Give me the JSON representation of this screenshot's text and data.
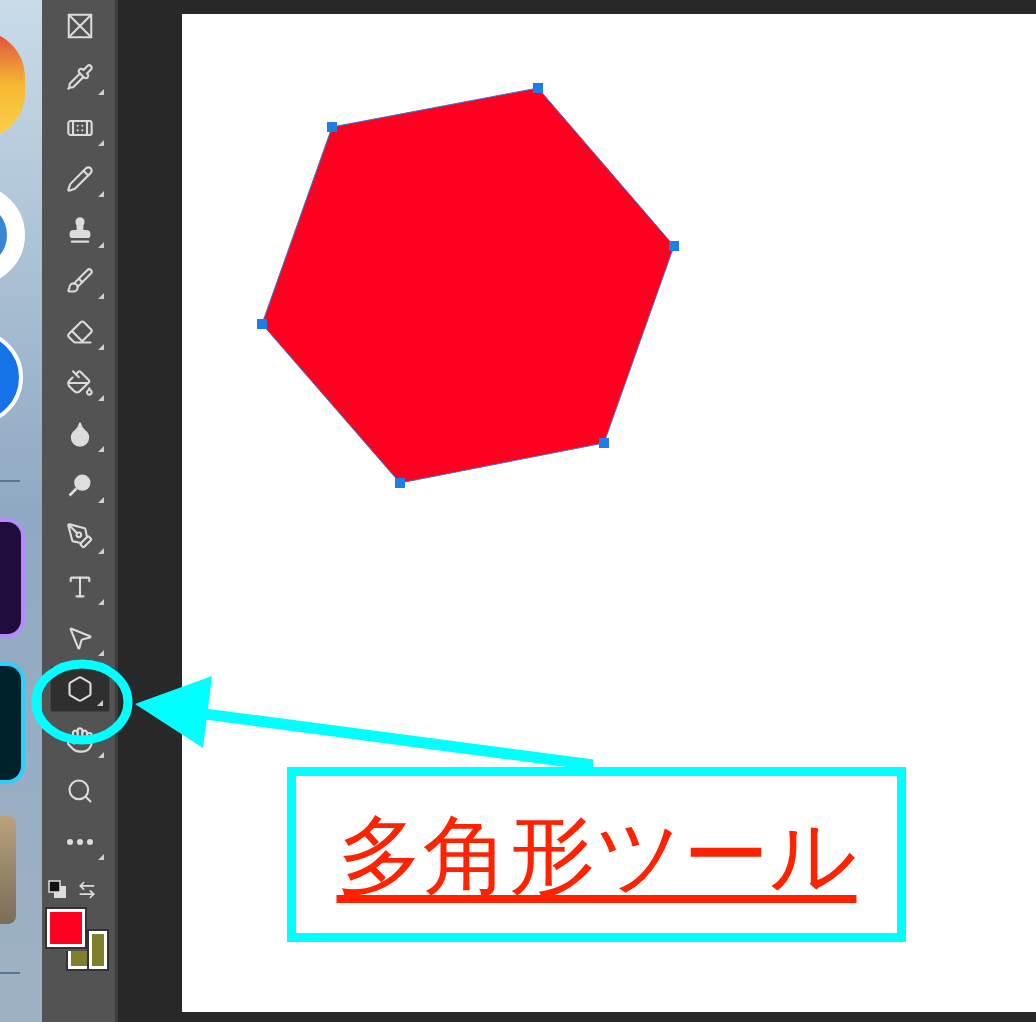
{
  "toolbar": {
    "tools": [
      {
        "kind": "frame",
        "selected": false,
        "has_menu": false
      },
      {
        "kind": "eyedropper",
        "selected": false,
        "has_menu": true
      },
      {
        "kind": "healing",
        "selected": false,
        "has_menu": true
      },
      {
        "kind": "pencil",
        "selected": false,
        "has_menu": true
      },
      {
        "kind": "stamp",
        "selected": false,
        "has_menu": true
      },
      {
        "kind": "history-brush",
        "selected": false,
        "has_menu": true
      },
      {
        "kind": "eraser",
        "selected": false,
        "has_menu": true
      },
      {
        "kind": "bucket",
        "selected": false,
        "has_menu": true
      },
      {
        "kind": "blur",
        "selected": false,
        "has_menu": true
      },
      {
        "kind": "dodge",
        "selected": false,
        "has_menu": true
      },
      {
        "kind": "pen",
        "selected": false,
        "has_menu": true
      },
      {
        "kind": "type",
        "selected": false,
        "has_menu": true
      },
      {
        "kind": "select",
        "selected": false,
        "has_menu": true
      },
      {
        "kind": "polygon",
        "selected": true,
        "has_menu": true
      },
      {
        "kind": "hand",
        "selected": false,
        "has_menu": true
      },
      {
        "kind": "zoom",
        "selected": false,
        "has_menu": false
      },
      {
        "kind": "more",
        "selected": false,
        "has_menu": true
      }
    ],
    "swatches": [
      {
        "kind": "foreground",
        "color": "#ff0020"
      },
      {
        "kind": "background",
        "color": "#7f7f2e"
      }
    ]
  },
  "annotation": {
    "label": "多角形ツール"
  }
}
